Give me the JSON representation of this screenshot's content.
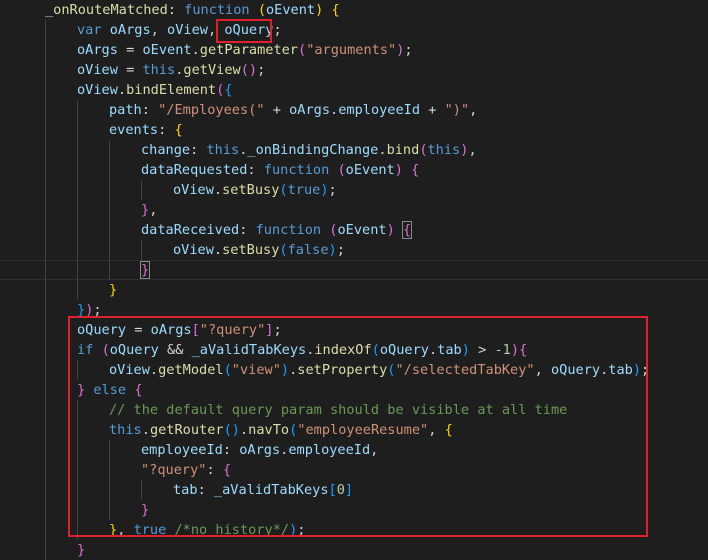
{
  "editor": {
    "theme": {
      "background": "#1e1e1e",
      "highlight_border": "#e0202a"
    },
    "lines": [
      {
        "indent": 1,
        "tokens": [
          [
            "_onRouteMatched",
            "fn"
          ],
          [
            ": ",
            "pn"
          ],
          [
            "function",
            "kw"
          ],
          [
            " ",
            "pn"
          ],
          [
            "(",
            "b1"
          ],
          [
            "oEvent",
            "var"
          ],
          [
            ")",
            "b1"
          ],
          [
            " ",
            "pn"
          ],
          [
            "{",
            "b1"
          ]
        ]
      },
      {
        "indent": 2,
        "tokens": [
          [
            "var",
            "kw"
          ],
          [
            " ",
            "pn"
          ],
          [
            "oArgs",
            "var"
          ],
          [
            ", ",
            "pn"
          ],
          [
            "oView",
            "var"
          ],
          [
            ", ",
            "pn"
          ],
          [
            "oQuery",
            "var"
          ],
          [
            ";",
            "pn"
          ]
        ]
      },
      {
        "indent": 2,
        "tokens": [
          [
            "oArgs",
            "var"
          ],
          [
            " = ",
            "pn"
          ],
          [
            "oEvent",
            "var"
          ],
          [
            ".",
            "pn"
          ],
          [
            "getParameter",
            "fn"
          ],
          [
            "(",
            "b2"
          ],
          [
            "\"arguments\"",
            "str"
          ],
          [
            ")",
            "b2"
          ],
          [
            ";",
            "pn"
          ]
        ]
      },
      {
        "indent": 2,
        "tokens": [
          [
            "oView",
            "var"
          ],
          [
            " = ",
            "pn"
          ],
          [
            "this",
            "kw"
          ],
          [
            ".",
            "pn"
          ],
          [
            "getView",
            "fn"
          ],
          [
            "(",
            "b2"
          ],
          [
            ")",
            "b2"
          ],
          [
            ";",
            "pn"
          ]
        ]
      },
      {
        "indent": 2,
        "tokens": [
          [
            "oView",
            "var"
          ],
          [
            ".",
            "pn"
          ],
          [
            "bindElement",
            "fn"
          ],
          [
            "(",
            "b2"
          ],
          [
            "{",
            "b3"
          ]
        ]
      },
      {
        "indent": 3,
        "tokens": [
          [
            "path",
            "var"
          ],
          [
            ": ",
            "pn"
          ],
          [
            "\"/Employees(\"",
            "str"
          ],
          [
            " + ",
            "pn"
          ],
          [
            "oArgs",
            "var"
          ],
          [
            ".",
            "pn"
          ],
          [
            "employeeId",
            "var"
          ],
          [
            " + ",
            "pn"
          ],
          [
            "\")\"",
            "str"
          ],
          [
            ",",
            "pn"
          ]
        ]
      },
      {
        "indent": 3,
        "tokens": [
          [
            "events",
            "var"
          ],
          [
            ": ",
            "pn"
          ],
          [
            "{",
            "b1"
          ]
        ]
      },
      {
        "indent": 4,
        "tokens": [
          [
            "change",
            "var"
          ],
          [
            ": ",
            "pn"
          ],
          [
            "this",
            "kw"
          ],
          [
            ".",
            "pn"
          ],
          [
            "_onBindingChange",
            "var"
          ],
          [
            ".",
            "pn"
          ],
          [
            "bind",
            "fn"
          ],
          [
            "(",
            "b2"
          ],
          [
            "this",
            "kw"
          ],
          [
            ")",
            "b2"
          ],
          [
            ",",
            "pn"
          ]
        ]
      },
      {
        "indent": 4,
        "tokens": [
          [
            "dataRequested",
            "var"
          ],
          [
            ": ",
            "pn"
          ],
          [
            "function",
            "kw"
          ],
          [
            " ",
            "pn"
          ],
          [
            "(",
            "b2"
          ],
          [
            "oEvent",
            "var"
          ],
          [
            ")",
            "b2"
          ],
          [
            " ",
            "pn"
          ],
          [
            "{",
            "b2"
          ]
        ]
      },
      {
        "indent": 5,
        "tokens": [
          [
            "oView",
            "var"
          ],
          [
            ".",
            "pn"
          ],
          [
            "setBusy",
            "fn"
          ],
          [
            "(",
            "b3"
          ],
          [
            "true",
            "kw"
          ],
          [
            ")",
            "b3"
          ],
          [
            ";",
            "pn"
          ]
        ]
      },
      {
        "indent": 4,
        "tokens": [
          [
            "}",
            "b2"
          ],
          [
            ",",
            "pn"
          ]
        ]
      },
      {
        "indent": 4,
        "tokens": [
          [
            "dataReceived",
            "var"
          ],
          [
            ": ",
            "pn"
          ],
          [
            "function",
            "kw"
          ],
          [
            " ",
            "pn"
          ],
          [
            "(",
            "b2"
          ],
          [
            "oEvent",
            "var"
          ],
          [
            ")",
            "b2"
          ],
          [
            " ",
            "pn"
          ],
          [
            "{",
            "b2m"
          ]
        ]
      },
      {
        "indent": 5,
        "tokens": [
          [
            "oView",
            "var"
          ],
          [
            ".",
            "pn"
          ],
          [
            "setBusy",
            "fn"
          ],
          [
            "(",
            "b3"
          ],
          [
            "false",
            "kw"
          ],
          [
            ")",
            "b3"
          ],
          [
            ";",
            "pn"
          ]
        ]
      },
      {
        "indent": 4,
        "tokens": [
          [
            "}",
            "b2m"
          ]
        ]
      },
      {
        "indent": 3,
        "tokens": [
          [
            "}",
            "b1"
          ]
        ]
      },
      {
        "indent": 2,
        "tokens": [
          [
            "}",
            "b3"
          ],
          [
            ")",
            "b2"
          ],
          [
            ";",
            "pn"
          ]
        ]
      },
      {
        "indent": 2,
        "tokens": [
          [
            "oQuery",
            "var"
          ],
          [
            " = ",
            "pn"
          ],
          [
            "oArgs",
            "var"
          ],
          [
            "[",
            "b2"
          ],
          [
            "\"?query\"",
            "str"
          ],
          [
            "]",
            "b2"
          ],
          [
            ";",
            "pn"
          ]
        ]
      },
      {
        "indent": 2,
        "tokens": [
          [
            "if",
            "kw"
          ],
          [
            " ",
            "pn"
          ],
          [
            "(",
            "b2"
          ],
          [
            "oQuery",
            "var"
          ],
          [
            " && ",
            "pn"
          ],
          [
            "_aValidTabKeys",
            "var"
          ],
          [
            ".",
            "pn"
          ],
          [
            "indexOf",
            "fn"
          ],
          [
            "(",
            "b3"
          ],
          [
            "oQuery",
            "var"
          ],
          [
            ".",
            "pn"
          ],
          [
            "tab",
            "var"
          ],
          [
            ")",
            "b3"
          ],
          [
            " > ",
            "pn"
          ],
          [
            "-1",
            "num"
          ],
          [
            ")",
            "b2"
          ],
          [
            "{",
            "b2"
          ]
        ]
      },
      {
        "indent": 3,
        "tokens": [
          [
            "oView",
            "var"
          ],
          [
            ".",
            "pn"
          ],
          [
            "getModel",
            "fn"
          ],
          [
            "(",
            "b3"
          ],
          [
            "\"view\"",
            "str"
          ],
          [
            ")",
            "b3"
          ],
          [
            ".",
            "pn"
          ],
          [
            "setProperty",
            "fn"
          ],
          [
            "(",
            "b3"
          ],
          [
            "\"/selectedTabKey\"",
            "str"
          ],
          [
            ", ",
            "pn"
          ],
          [
            "oQuery",
            "var"
          ],
          [
            ".",
            "pn"
          ],
          [
            "tab",
            "var"
          ],
          [
            ")",
            "b3"
          ],
          [
            ";",
            "pn"
          ]
        ]
      },
      {
        "indent": 2,
        "tokens": [
          [
            "}",
            "b2"
          ],
          [
            " ",
            "pn"
          ],
          [
            "else",
            "kw"
          ],
          [
            " ",
            "pn"
          ],
          [
            "{",
            "b2"
          ]
        ]
      },
      {
        "indent": 3,
        "tokens": [
          [
            "// the default query param should be visible at all time",
            "cm"
          ]
        ]
      },
      {
        "indent": 3,
        "tokens": [
          [
            "this",
            "kw"
          ],
          [
            ".",
            "pn"
          ],
          [
            "getRouter",
            "fn"
          ],
          [
            "(",
            "b3"
          ],
          [
            ")",
            "b3"
          ],
          [
            ".",
            "pn"
          ],
          [
            "navTo",
            "fn"
          ],
          [
            "(",
            "b3"
          ],
          [
            "\"employeeResume\"",
            "str"
          ],
          [
            ", ",
            "pn"
          ],
          [
            "{",
            "b1"
          ]
        ]
      },
      {
        "indent": 4,
        "tokens": [
          [
            "employeeId",
            "var"
          ],
          [
            ": ",
            "pn"
          ],
          [
            "oArgs",
            "var"
          ],
          [
            ".",
            "pn"
          ],
          [
            "employeeId",
            "var"
          ],
          [
            ",",
            "pn"
          ]
        ]
      },
      {
        "indent": 4,
        "tokens": [
          [
            "\"?query\"",
            "str"
          ],
          [
            ": ",
            "pn"
          ],
          [
            "{",
            "b2"
          ]
        ]
      },
      {
        "indent": 5,
        "tokens": [
          [
            "tab",
            "var"
          ],
          [
            ": ",
            "pn"
          ],
          [
            "_aValidTabKeys",
            "var"
          ],
          [
            "[",
            "b3"
          ],
          [
            "0",
            "num"
          ],
          [
            "]",
            "b3"
          ]
        ]
      },
      {
        "indent": 4,
        "tokens": [
          [
            "}",
            "b2"
          ]
        ]
      },
      {
        "indent": 3,
        "tokens": [
          [
            "}",
            "b1"
          ],
          [
            ", ",
            "pn"
          ],
          [
            "true",
            "kw"
          ],
          [
            " ",
            "pn"
          ],
          [
            "/*no history*/",
            "cm"
          ],
          [
            ")",
            "b3"
          ],
          [
            ";",
            "pn"
          ]
        ]
      },
      {
        "indent": 2,
        "tokens": [
          [
            "}",
            "b2"
          ]
        ]
      }
    ]
  }
}
